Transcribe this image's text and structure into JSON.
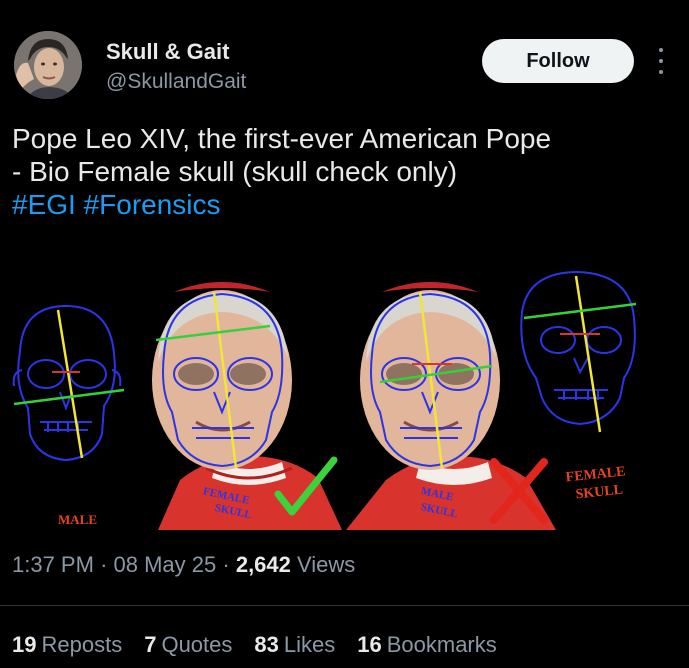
{
  "author": {
    "name": "Skull & Gait",
    "handle": "@SkullandGait"
  },
  "header": {
    "follow_label": "Follow",
    "more_icon": "more-vertical-icon"
  },
  "post": {
    "line1": "Pope Leo XIV, the first-ever American Pope",
    "line2": "- Bio Female skull (skull check only)",
    "hashtags": [
      "#EGI",
      "#Forensics"
    ]
  },
  "media": {
    "label_male": "MALE",
    "label_female_skull": [
      "FEMALE",
      "SKULL"
    ],
    "badge_left": [
      "FEMALE",
      "SKULL"
    ],
    "badge_right": [
      "MALE",
      "SKULL"
    ],
    "check_icon": "check-icon",
    "cross_icon": "x-icon",
    "colors": {
      "background": "#000000",
      "skull_outline": "#2b35e6",
      "check": "#3cd23c",
      "cross": "#e3261c",
      "label": "#e8431f"
    }
  },
  "meta": {
    "time": "1:37 PM",
    "date": "08 May 25",
    "views_count": "2,642",
    "views_label": "Views",
    "sep": "·"
  },
  "stats": [
    {
      "count": "19",
      "label": "Reposts"
    },
    {
      "count": "7",
      "label": "Quotes"
    },
    {
      "count": "83",
      "label": "Likes"
    },
    {
      "count": "16",
      "label": "Bookmarks"
    }
  ]
}
